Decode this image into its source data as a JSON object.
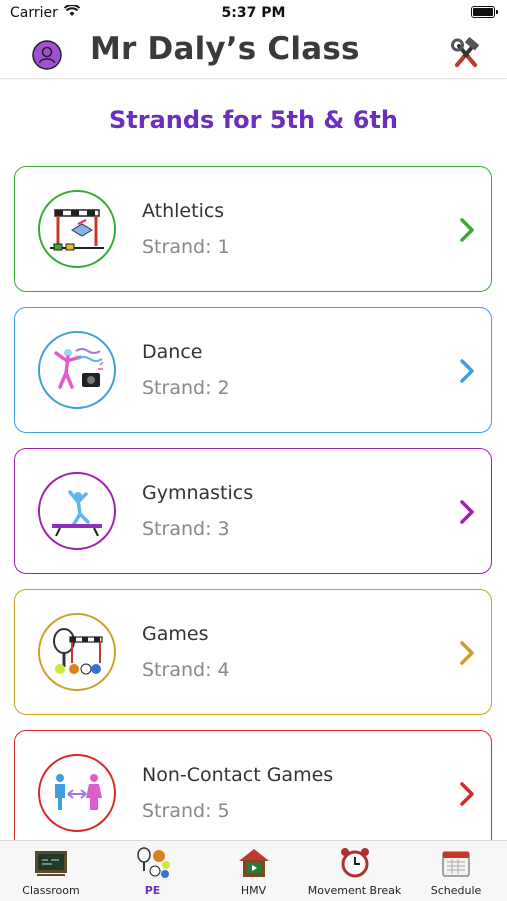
{
  "status_bar": {
    "carrier": "Carrier",
    "time": "5:37 PM"
  },
  "header": {
    "title": "Mr Daly’s Class"
  },
  "subtitle": "Strands for 5th & 6th",
  "strands": [
    {
      "name": "Athletics",
      "strand": "Strand: 1",
      "color": "#3aaa35",
      "icon": "athletics-hurdle-icon"
    },
    {
      "name": "Dance",
      "strand": "Strand: 2",
      "color": "#3b9fe0",
      "icon": "dance-icon"
    },
    {
      "name": "Gymnastics",
      "strand": "Strand: 3",
      "color": "#a020b0",
      "icon": "gymnastics-icon"
    },
    {
      "name": "Games",
      "strand": "Strand: 4",
      "color": "#c9a227",
      "icon": "games-icon"
    },
    {
      "name": "Non-Contact Games",
      "strand": "Strand: 5",
      "color": "#d62828",
      "icon": "non-contact-games-icon"
    }
  ],
  "tabs": [
    {
      "label": "Classroom",
      "icon": "classroom-blackboard-icon",
      "active": false
    },
    {
      "label": "PE",
      "icon": "pe-sports-balls-icon",
      "active": true
    },
    {
      "label": "HMV",
      "icon": "hmv-house-icon",
      "active": false
    },
    {
      "label": "Movement Break",
      "icon": "alarm-clock-icon",
      "active": false
    },
    {
      "label": "Schedule",
      "icon": "calendar-icon",
      "active": false
    }
  ],
  "colors": {
    "accent": "#6a2fbf",
    "title": "#3a3a3a"
  }
}
